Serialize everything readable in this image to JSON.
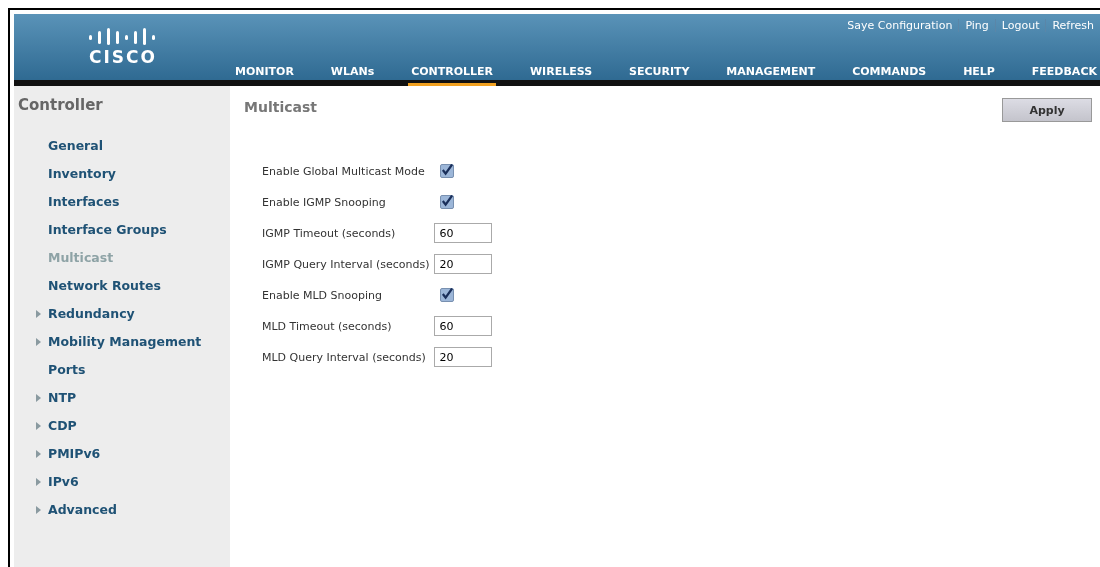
{
  "header": {
    "logo": "CISCO",
    "top_links": [
      "Saye Configuration",
      "Ping",
      "Logout",
      "Refresh"
    ],
    "nav": [
      {
        "label": "MONITOR",
        "selected": false
      },
      {
        "label": "WLANs",
        "selected": false
      },
      {
        "label": "CONTROLLER",
        "selected": true
      },
      {
        "label": "WIRELESS",
        "selected": false
      },
      {
        "label": "SECURITY",
        "selected": false
      },
      {
        "label": "MANAGEMENT",
        "selected": false
      },
      {
        "label": "COMMANDS",
        "selected": false
      },
      {
        "label": "HELP",
        "selected": false
      },
      {
        "label": "FEEDBACK",
        "selected": false
      }
    ]
  },
  "sidebar": {
    "title": "Controller",
    "items": [
      {
        "label": "General",
        "selected": false,
        "expandable": false
      },
      {
        "label": "Inventory",
        "selected": false,
        "expandable": false
      },
      {
        "label": "Interfaces",
        "selected": false,
        "expandable": false
      },
      {
        "label": "Interface Groups",
        "selected": false,
        "expandable": false
      },
      {
        "label": "Multicast",
        "selected": true,
        "expandable": false
      },
      {
        "label": "Network Routes",
        "selected": false,
        "expandable": false
      },
      {
        "label": "Redundancy",
        "selected": false,
        "expandable": true
      },
      {
        "label": "Mobility Management",
        "selected": false,
        "expandable": true
      },
      {
        "label": "Ports",
        "selected": false,
        "expandable": false
      },
      {
        "label": "NTP",
        "selected": false,
        "expandable": true
      },
      {
        "label": "CDP",
        "selected": false,
        "expandable": true
      },
      {
        "label": "PMIPv6",
        "selected": false,
        "expandable": true
      },
      {
        "label": "IPv6",
        "selected": false,
        "expandable": true
      },
      {
        "label": "Advanced",
        "selected": false,
        "expandable": true
      }
    ]
  },
  "main": {
    "title": "Multicast",
    "apply_button": "Apply",
    "settings": [
      {
        "kind": "checkbox",
        "label": "Enable Global Multicast Mode",
        "checked": true
      },
      {
        "kind": "checkbox",
        "label": "Enable IGMP Snooping",
        "checked": true
      },
      {
        "kind": "number",
        "label": "IGMP Timeout (seconds)",
        "value": "60"
      },
      {
        "kind": "number",
        "label": "IGMP Query Interval (seconds)",
        "value": "20"
      },
      {
        "kind": "checkbox",
        "label": "Enable MLD Snooping",
        "checked": true
      },
      {
        "kind": "number",
        "label": "MLD Timeout (seconds)",
        "value": "60"
      },
      {
        "kind": "number",
        "label": "MLD Query Interval (seconds)",
        "value": "20"
      }
    ]
  }
}
